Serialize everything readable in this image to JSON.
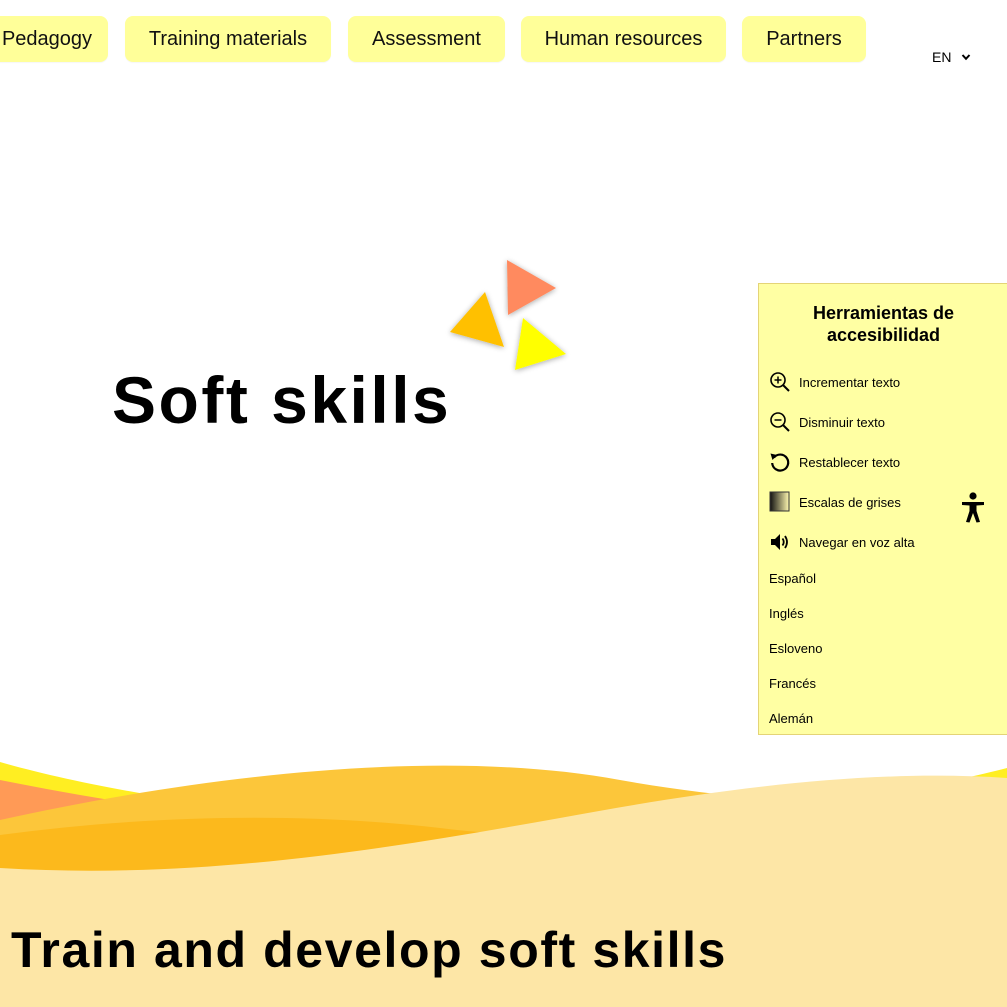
{
  "nav": {
    "items": [
      {
        "label": "Pedagogy"
      },
      {
        "label": "Training materials"
      },
      {
        "label": "Assessment"
      },
      {
        "label": "Human resources"
      },
      {
        "label": "Partners"
      }
    ],
    "language": "EN"
  },
  "hero": {
    "title": "Soft skills"
  },
  "footer_band": {
    "title": "Train and develop soft skills"
  },
  "accessibility": {
    "title_line1": "Herramientas de",
    "title_line2": "accesibilidad",
    "tools": [
      {
        "label": "Incrementar texto",
        "icon": "zoom-in-icon"
      },
      {
        "label": "Disminuir texto",
        "icon": "zoom-out-icon"
      },
      {
        "label": "Restablecer texto",
        "icon": "reset-icon"
      },
      {
        "label": "Escalas de grises",
        "icon": "grayscale-icon"
      },
      {
        "label": "Navegar en voz alta",
        "icon": "speaker-icon"
      }
    ],
    "languages": [
      {
        "label": "Español"
      },
      {
        "label": "Inglés"
      },
      {
        "label": "Esloveno"
      },
      {
        "label": "Francés"
      },
      {
        "label": "Alemán"
      }
    ],
    "toggle_icon": "accessibility-person-icon"
  },
  "colors": {
    "nav_bg": "#ffff99",
    "panel_bg": "#ffffa3",
    "wave_light": "#fde6a6",
    "wave_orange": "#fbb618",
    "wave_yellow": "#ffee22",
    "triangle_salmon": "#ff8a5e",
    "triangle_amber": "#ffc000",
    "triangle_yellow": "#ffff00"
  }
}
